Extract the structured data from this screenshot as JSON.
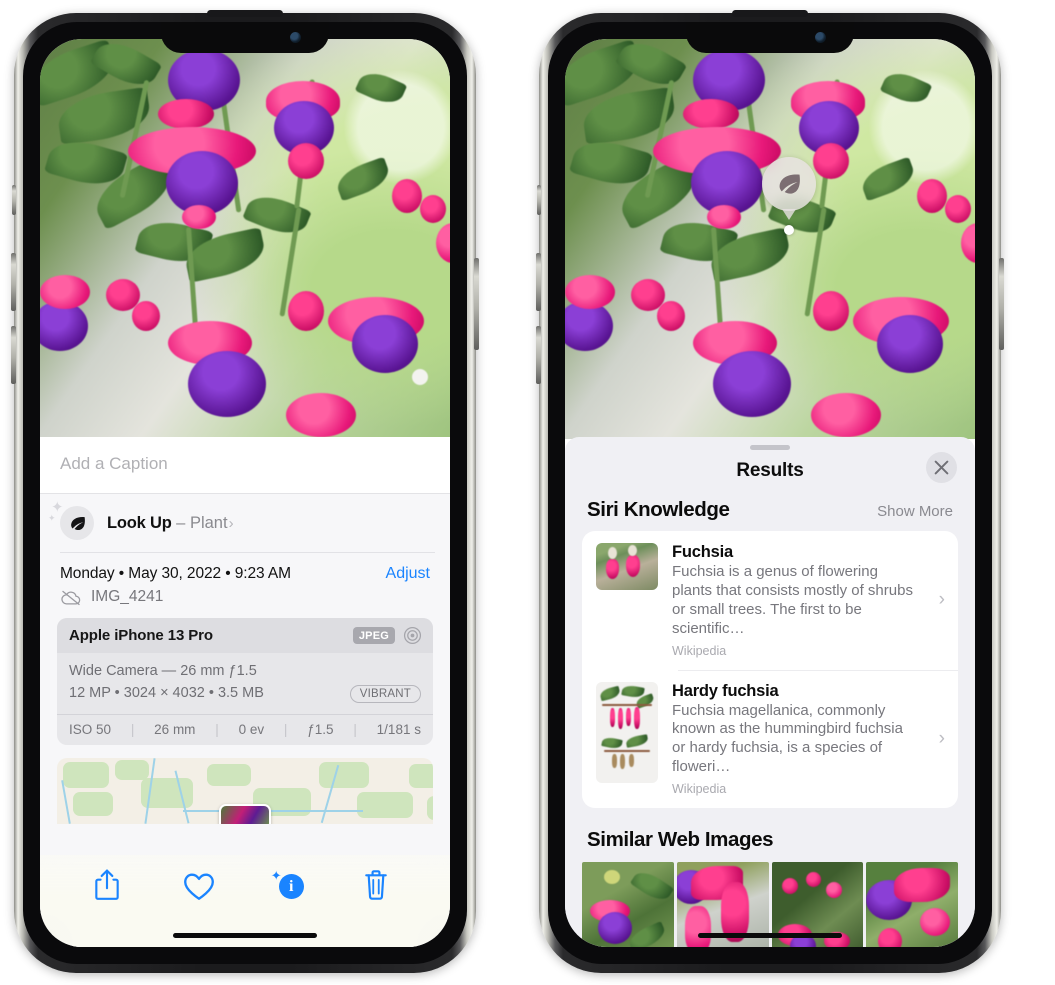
{
  "left_phone": {
    "photo": {
      "alt": "fuchsia-flowers-photo"
    },
    "caption_placeholder": "Add a Caption",
    "lookup": {
      "icon": "leaf-icon",
      "sparkle": "✦",
      "title": "Look Up",
      "dash": " – ",
      "subject": "Plant",
      "chevron": "›"
    },
    "meta": {
      "date": "Monday • May 30, 2022 • 9:23 AM",
      "adjust_label": "Adjust",
      "cloud_icon": "cloud-slash-icon",
      "filename": "IMG_4241"
    },
    "camera": {
      "model": "Apple iPhone 13 Pro",
      "format_tag": "JPEG",
      "aperture_icon": "aperture-icon",
      "lens_line": "Wide Camera — 26 mm ƒ1.5",
      "specs_line": "12 MP • 3024 × 4032 • 3.5 MB",
      "style_tag": "VIBRANT",
      "exif": [
        "ISO 50",
        "26 mm",
        "0 ev",
        "ƒ1.5",
        "1/181 s"
      ],
      "exif_sep": "|"
    },
    "map": {
      "name": "location-map"
    },
    "toolbar": [
      {
        "name": "share-button",
        "icon": "share-icon"
      },
      {
        "name": "favorite-button",
        "icon": "heart-icon"
      },
      {
        "name": "info-button",
        "icon": "info-sparkle-icon",
        "glyph": "i",
        "sparkle": "✦"
      },
      {
        "name": "delete-button",
        "icon": "trash-icon"
      }
    ]
  },
  "right_phone": {
    "visual_lookup": {
      "icon": "leaf-icon",
      "name": "visual-lookup-badge"
    },
    "sheet": {
      "title": "Results",
      "close_icon": "close-icon",
      "siri": {
        "heading": "Siri Knowledge",
        "show_more": "Show More",
        "items": [
          {
            "title": "Fuchsia",
            "description": "Fuchsia is a genus of flowering plants that consists mostly of shrubs or small trees. The first to be scientific…",
            "source": "Wikipedia",
            "chevron": "›",
            "thumb": "fuchsia-red-flowers-thumb"
          },
          {
            "title": "Hardy fuchsia",
            "description": "Fuchsia magellanica, commonly known as the hummingbird fuchsia or hardy fuchsia, is a species of floweri…",
            "source": "Wikipedia",
            "chevron": "›",
            "thumb": "hardy-fuchsia-specimen-thumb"
          }
        ]
      },
      "similar": {
        "heading": "Similar Web Images",
        "images": [
          {
            "name": "web-image-1"
          },
          {
            "name": "web-image-2"
          },
          {
            "name": "web-image-3"
          },
          {
            "name": "web-image-4"
          }
        ]
      }
    }
  },
  "colors": {
    "accent_blue": "#1a84ff",
    "sheet_bg": "#f0f0f4",
    "card_bg": "#ffffff",
    "secondary_text": "#77777d"
  }
}
